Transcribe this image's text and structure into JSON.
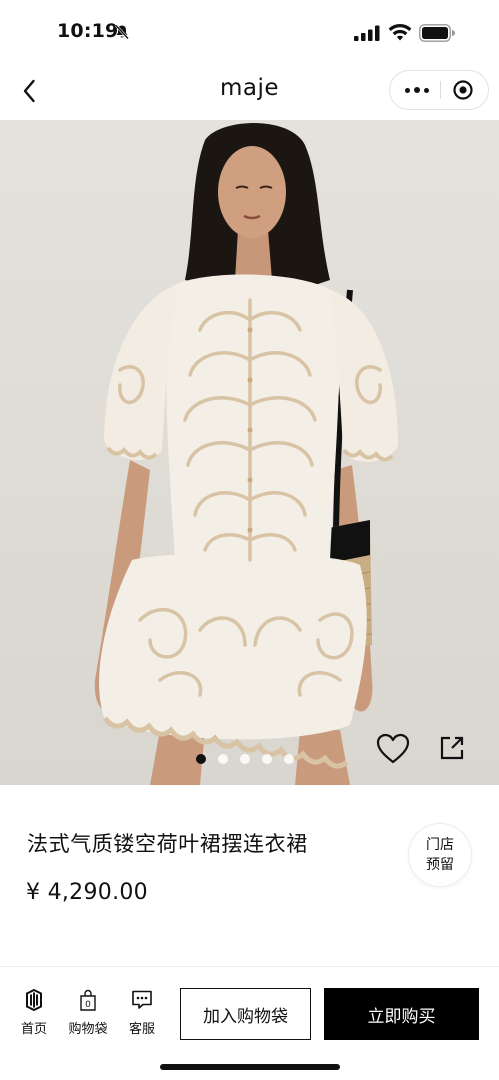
{
  "status_bar": {
    "time": "10:19",
    "icons": [
      "bell-off-icon",
      "signal-icon",
      "wifi-icon",
      "battery-icon"
    ]
  },
  "nav": {
    "title": "maje",
    "back_icon": "chevron-left-icon",
    "more_icon": "more-dots-icon",
    "close_icon": "target-close-icon"
  },
  "product": {
    "title": "法式气质镂空荷叶裙摆连衣裙",
    "price": "¥ 4,290.00",
    "store_reserve_line1": "门店",
    "store_reserve_line2": "预留",
    "image_dots_total": 5,
    "image_dots_active": 1
  },
  "bottom_bar": {
    "tabs": [
      {
        "label": "首页",
        "icon": "home-logo-icon"
      },
      {
        "label": "购物袋",
        "icon": "shopping-bag-icon",
        "badge": "0"
      },
      {
        "label": "客服",
        "icon": "chat-icon"
      }
    ],
    "add_to_bag": "加入购物袋",
    "buy_now": "立即购买"
  },
  "colors": {
    "primary": "#000000",
    "background": "#ffffff",
    "hero_bg": "#e2dfda",
    "dress": "#f4efe6",
    "embroidery": "#d8c3a5"
  }
}
